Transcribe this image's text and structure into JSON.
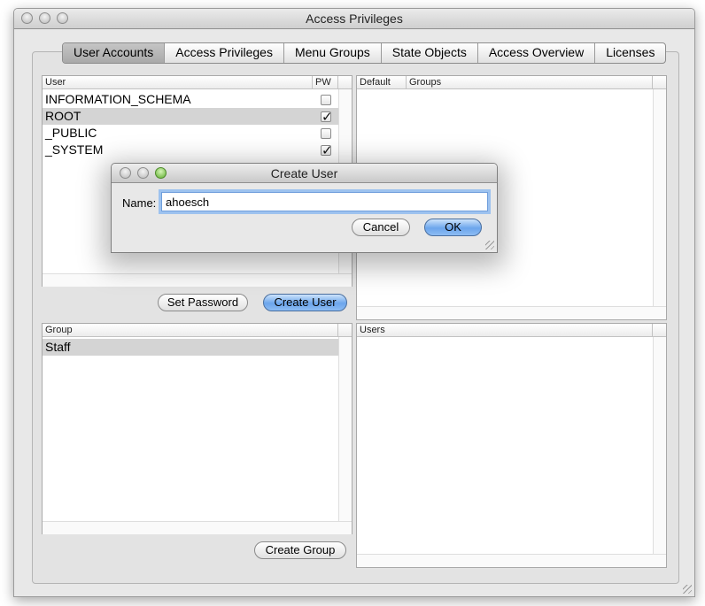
{
  "window": {
    "title": "Access Privileges"
  },
  "tabs": [
    "User Accounts",
    "Access Privileges",
    "Menu Groups",
    "State Objects",
    "Access Overview",
    "Licenses"
  ],
  "selected_tab": "User Accounts",
  "users_table": {
    "headers": {
      "user": "User",
      "pw": "PW"
    },
    "rows": [
      {
        "name": "INFORMATION_SCHEMA",
        "pw": false,
        "selected": false
      },
      {
        "name": "ROOT",
        "pw": true,
        "selected": true
      },
      {
        "name": "_PUBLIC",
        "pw": false,
        "selected": false
      },
      {
        "name": "_SYSTEM",
        "pw": true,
        "selected": false
      }
    ]
  },
  "privileges_table": {
    "headers": {
      "default": "Default",
      "groups": "Groups"
    }
  },
  "buttons": {
    "set_password": "Set Password",
    "create_user": "Create User",
    "create_group": "Create Group"
  },
  "groups_table": {
    "headers": {
      "group": "Group"
    },
    "rows": [
      {
        "name": "Staff",
        "selected": true
      }
    ]
  },
  "users_in_group_table": {
    "headers": {
      "users": "Users"
    }
  },
  "dialog": {
    "title": "Create User",
    "name_label": "Name:",
    "name_value": "ahoesch",
    "cancel_label": "Cancel",
    "ok_label": "OK"
  },
  "check_glyph": "✓",
  "colors": {
    "selected_row": "#d4d4d4",
    "default_button": "#6ba5ec",
    "focus_ring": "#9dc2ef"
  }
}
